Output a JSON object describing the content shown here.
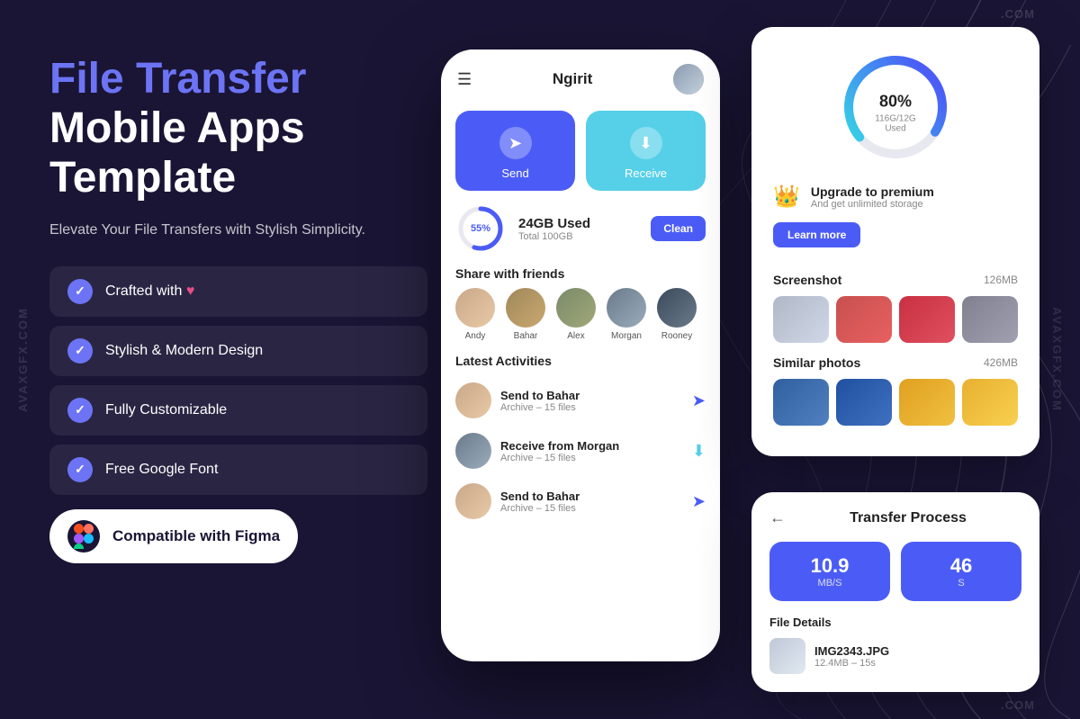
{
  "page": {
    "background": "#1a1535",
    "watermark_left": "AVAXGFX.COM",
    "watermark_right": "AVAXGFX.COM",
    "watermark_top_right": ".COM",
    "watermark_bottom_right": ".COM"
  },
  "left": {
    "title_line1": "File Transfer",
    "title_line2": "Mobile Apps",
    "title_line3": "Template",
    "subtitle": "Elevate Your File Transfers with Stylish Simplicity.",
    "features": [
      {
        "id": "crafted",
        "label": "Crafted with ♥"
      },
      {
        "id": "design",
        "label": "Stylish & Modern Design"
      },
      {
        "id": "customize",
        "label": "Fully Customizable"
      },
      {
        "id": "font",
        "label": "Free Google Font"
      }
    ],
    "figma_label": "Compatible with Figma"
  },
  "phone": {
    "app_name": "Ngirit",
    "send_label": "Send",
    "receive_label": "Receive",
    "storage_percent": "55%",
    "storage_used": "24GB Used",
    "storage_total": "Total 100GB",
    "clean_btn": "Clean",
    "share_title": "Share with friends",
    "friends": [
      {
        "name": "Andy"
      },
      {
        "name": "Bahar"
      },
      {
        "name": "Alex"
      },
      {
        "name": "Morgan"
      },
      {
        "name": "Rooney"
      }
    ],
    "activities_title": "Latest Activities",
    "activities": [
      {
        "title": "Send to Bahar",
        "sub": "Archive – 15 files",
        "type": "send"
      },
      {
        "title": "Receive from Morgan",
        "sub": "Archive – 15 files",
        "type": "receive"
      },
      {
        "title": "Send to Bahar",
        "sub": "Archive – 15 files",
        "type": "send"
      }
    ]
  },
  "right_top": {
    "gauge_percent": "80",
    "gauge_unit": "%",
    "gauge_sub": "116G/12G Used",
    "premium_title": "Upgrade to premium",
    "premium_sub": "And get unlimited storage",
    "learn_btn": "Learn more",
    "screenshot_section": "Screenshot",
    "screenshot_size": "126MB",
    "similar_section": "Similar photos",
    "similar_size": "426MB"
  },
  "right_bottom": {
    "title": "Transfer Process",
    "stat1_number": "10.9",
    "stat1_unit": "MB/S",
    "stat2_number": "46",
    "stat2_unit": "S",
    "file_details": "File Details",
    "file_name": "IMG2343.JPG",
    "file_sub": "12.4MB – 15s"
  }
}
